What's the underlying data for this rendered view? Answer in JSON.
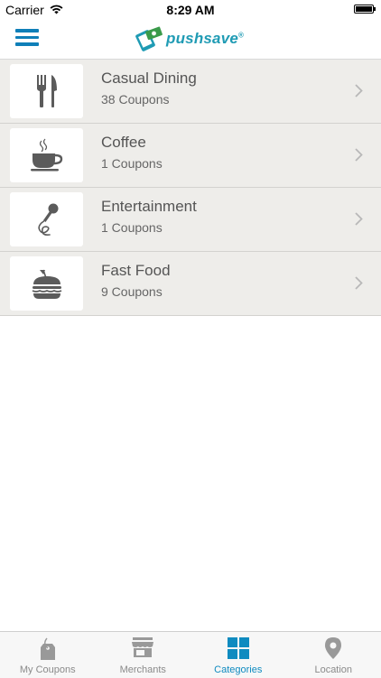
{
  "status_bar": {
    "carrier": "Carrier",
    "time": "8:29 AM"
  },
  "nav": {
    "logo_text": "pushsave",
    "logo_mark": "®"
  },
  "categories": [
    {
      "title": "Casual Dining",
      "subtitle": "38 Coupons",
      "icon": "fork-knife-icon"
    },
    {
      "title": "Coffee",
      "subtitle": "1 Coupons",
      "icon": "coffee-cup-icon"
    },
    {
      "title": "Entertainment",
      "subtitle": "1 Coupons",
      "icon": "microphone-icon"
    },
    {
      "title": "Fast Food",
      "subtitle": "9 Coupons",
      "icon": "burger-icon"
    }
  ],
  "tabs": [
    {
      "label": "My Coupons",
      "icon": "coupon-tag-icon",
      "active": false
    },
    {
      "label": "Merchants",
      "icon": "storefront-icon",
      "active": false
    },
    {
      "label": "Categories",
      "icon": "grid-icon",
      "active": true
    },
    {
      "label": "Location",
      "icon": "location-pin-icon",
      "active": false
    }
  ],
  "colors": {
    "accent": "#0f8bc0",
    "menu": "#0f7fb8",
    "row_bg": "#eeedea",
    "icon_gray": "#5b5b5b",
    "tab_inactive": "#8a8a8a"
  }
}
